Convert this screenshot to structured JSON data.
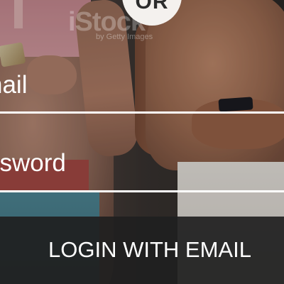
{
  "avatar": {
    "label": "OR"
  },
  "watermark": {
    "brand": "iStock",
    "credit": "by Getty Images"
  },
  "form": {
    "email": {
      "label": "nail"
    },
    "password": {
      "label": "ssword"
    }
  },
  "login_button": {
    "label": "LOGIN WITH EMAIL"
  }
}
